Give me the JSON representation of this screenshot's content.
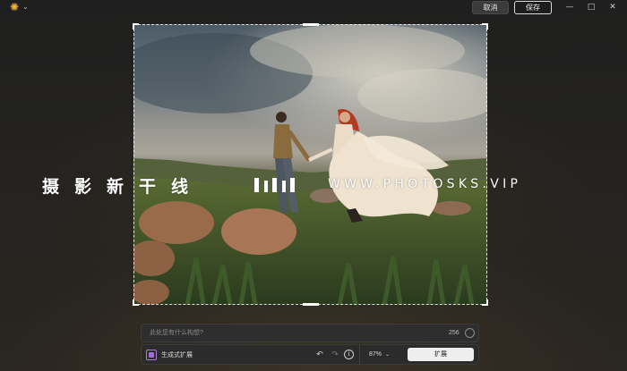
{
  "titlebar": {
    "app_icon": "sun-icon",
    "menu_icon": "chevron-down-icon",
    "cancel_label": "取消",
    "save_label": "保存",
    "minimize_icon": "minimize-icon",
    "maximize_icon": "maximize-icon",
    "close_icon": "close-icon"
  },
  "watermark": {
    "chinese": "摄影新干线",
    "english": "WWW.PHOTOSKS.VIP",
    "logo_icon": "three-bars-logo-icon"
  },
  "prompt": {
    "placeholder": "此处您有什么构想?",
    "value": "",
    "char_count": "256"
  },
  "action_bar": {
    "feature_icon": "generative-expand-icon",
    "feature_label": "生成式扩展",
    "undo_icon": "undo-icon",
    "redo_icon": "redo-icon",
    "info_icon": "info-icon",
    "zoom": "87%",
    "expand_label": "扩展"
  },
  "colors": {
    "accent_purple": "#9d6cd6",
    "app_icon": "#f2b53a",
    "save_border": "#dcdcdc"
  }
}
